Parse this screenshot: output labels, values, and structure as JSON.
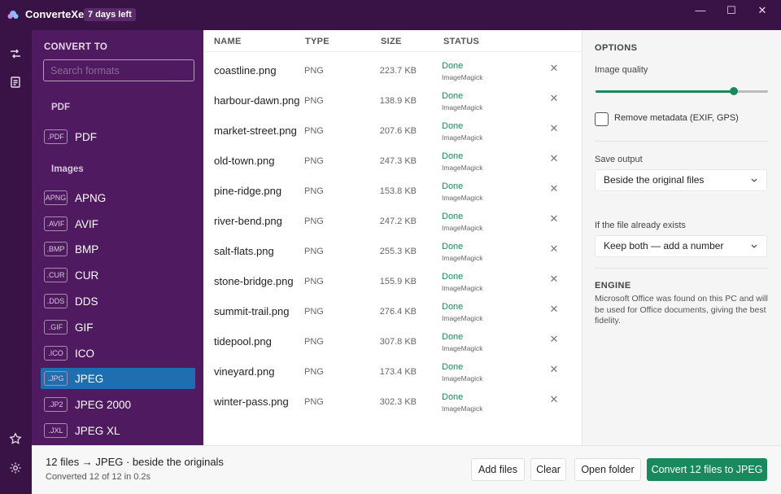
{
  "app": {
    "name": "ConverteXe",
    "badge": "7 days left",
    "logo_icon": "app-logo"
  },
  "window_controls": {
    "minimize": "—",
    "maximize": "☐",
    "close": "✕"
  },
  "rail": {
    "top_icons": [
      "shuffle-icon",
      "document-icon"
    ],
    "bottom_icons": [
      "star-icon",
      "gear-icon"
    ]
  },
  "sidebar": {
    "title": "CONVERT TO",
    "search_placeholder": "Search formats",
    "groups": [
      {
        "label": "PDF",
        "formats": [
          {
            "ext": ".PDF",
            "name": "PDF"
          }
        ]
      },
      {
        "label": "Images",
        "formats": [
          {
            "ext": "APNG",
            "name": "APNG"
          },
          {
            "ext": ".AVIF",
            "name": "AVIF"
          },
          {
            "ext": ".BMP",
            "name": "BMP"
          },
          {
            "ext": ".CUR",
            "name": "CUR"
          },
          {
            "ext": ".DDS",
            "name": "DDS"
          },
          {
            "ext": ".GIF",
            "name": "GIF"
          },
          {
            "ext": ".ICO",
            "name": "ICO"
          },
          {
            "ext": ".JPG",
            "name": "JPEG",
            "selected": true
          },
          {
            "ext": ".JP2",
            "name": "JPEG 2000"
          },
          {
            "ext": ".JXL",
            "name": "JPEG XL"
          }
        ]
      }
    ],
    "selected_color": "#1f6fb0"
  },
  "table": {
    "headers": {
      "name": "NAME",
      "type": "TYPE",
      "size": "SIZE",
      "status": "STATUS"
    },
    "rows": [
      {
        "name": "coastline.png",
        "type": "PNG",
        "size": "223.7 KB",
        "status": "Done",
        "engine": "ImageMagick"
      },
      {
        "name": "harbour-dawn.png",
        "type": "PNG",
        "size": "138.9 KB",
        "status": "Done",
        "engine": "ImageMagick"
      },
      {
        "name": "market-street.png",
        "type": "PNG",
        "size": "207.6 KB",
        "status": "Done",
        "engine": "ImageMagick"
      },
      {
        "name": "old-town.png",
        "type": "PNG",
        "size": "247.3 KB",
        "status": "Done",
        "engine": "ImageMagick"
      },
      {
        "name": "pine-ridge.png",
        "type": "PNG",
        "size": "153.8 KB",
        "status": "Done",
        "engine": "ImageMagick"
      },
      {
        "name": "river-bend.png",
        "type": "PNG",
        "size": "247.2 KB",
        "status": "Done",
        "engine": "ImageMagick"
      },
      {
        "name": "salt-flats.png",
        "type": "PNG",
        "size": "255.3 KB",
        "status": "Done",
        "engine": "ImageMagick"
      },
      {
        "name": "stone-bridge.png",
        "type": "PNG",
        "size": "155.9 KB",
        "status": "Done",
        "engine": "ImageMagick"
      },
      {
        "name": "summit-trail.png",
        "type": "PNG",
        "size": "276.4 KB",
        "status": "Done",
        "engine": "ImageMagick"
      },
      {
        "name": "tidepool.png",
        "type": "PNG",
        "size": "307.8 KB",
        "status": "Done",
        "engine": "ImageMagick"
      },
      {
        "name": "vineyard.png",
        "type": "PNG",
        "size": "173.4 KB",
        "status": "Done",
        "engine": "ImageMagick"
      },
      {
        "name": "winter-pass.png",
        "type": "PNG",
        "size": "302.3 KB",
        "status": "Done",
        "engine": "ImageMagick"
      }
    ],
    "remove_glyph": "✕",
    "status_color": "#1a8a5a"
  },
  "options": {
    "title": "OPTIONS",
    "quality_label": "Image quality",
    "quality_fraction": 0.8,
    "remove_metadata_label": "Remove metadata (EXIF, GPS)",
    "remove_metadata_checked": false,
    "save_output_label": "Save output",
    "save_output_value": "Beside the original files",
    "exists_label": "If the file already exists",
    "exists_value": "Keep both — add a number",
    "engine_title": "ENGINE",
    "engine_text": "Microsoft Office was found on this PC and will be used for Office documents, giving the best fidelity.",
    "accent": "#188a5e"
  },
  "bottom": {
    "summary": "12 files  →  JPEG  ·  beside the originals",
    "sub": "Converted 12 of 12 in 0.2s",
    "add_files": "Add files",
    "clear": "Clear",
    "open_folder": "Open folder",
    "convert": "Convert 12 files to JPEG"
  }
}
